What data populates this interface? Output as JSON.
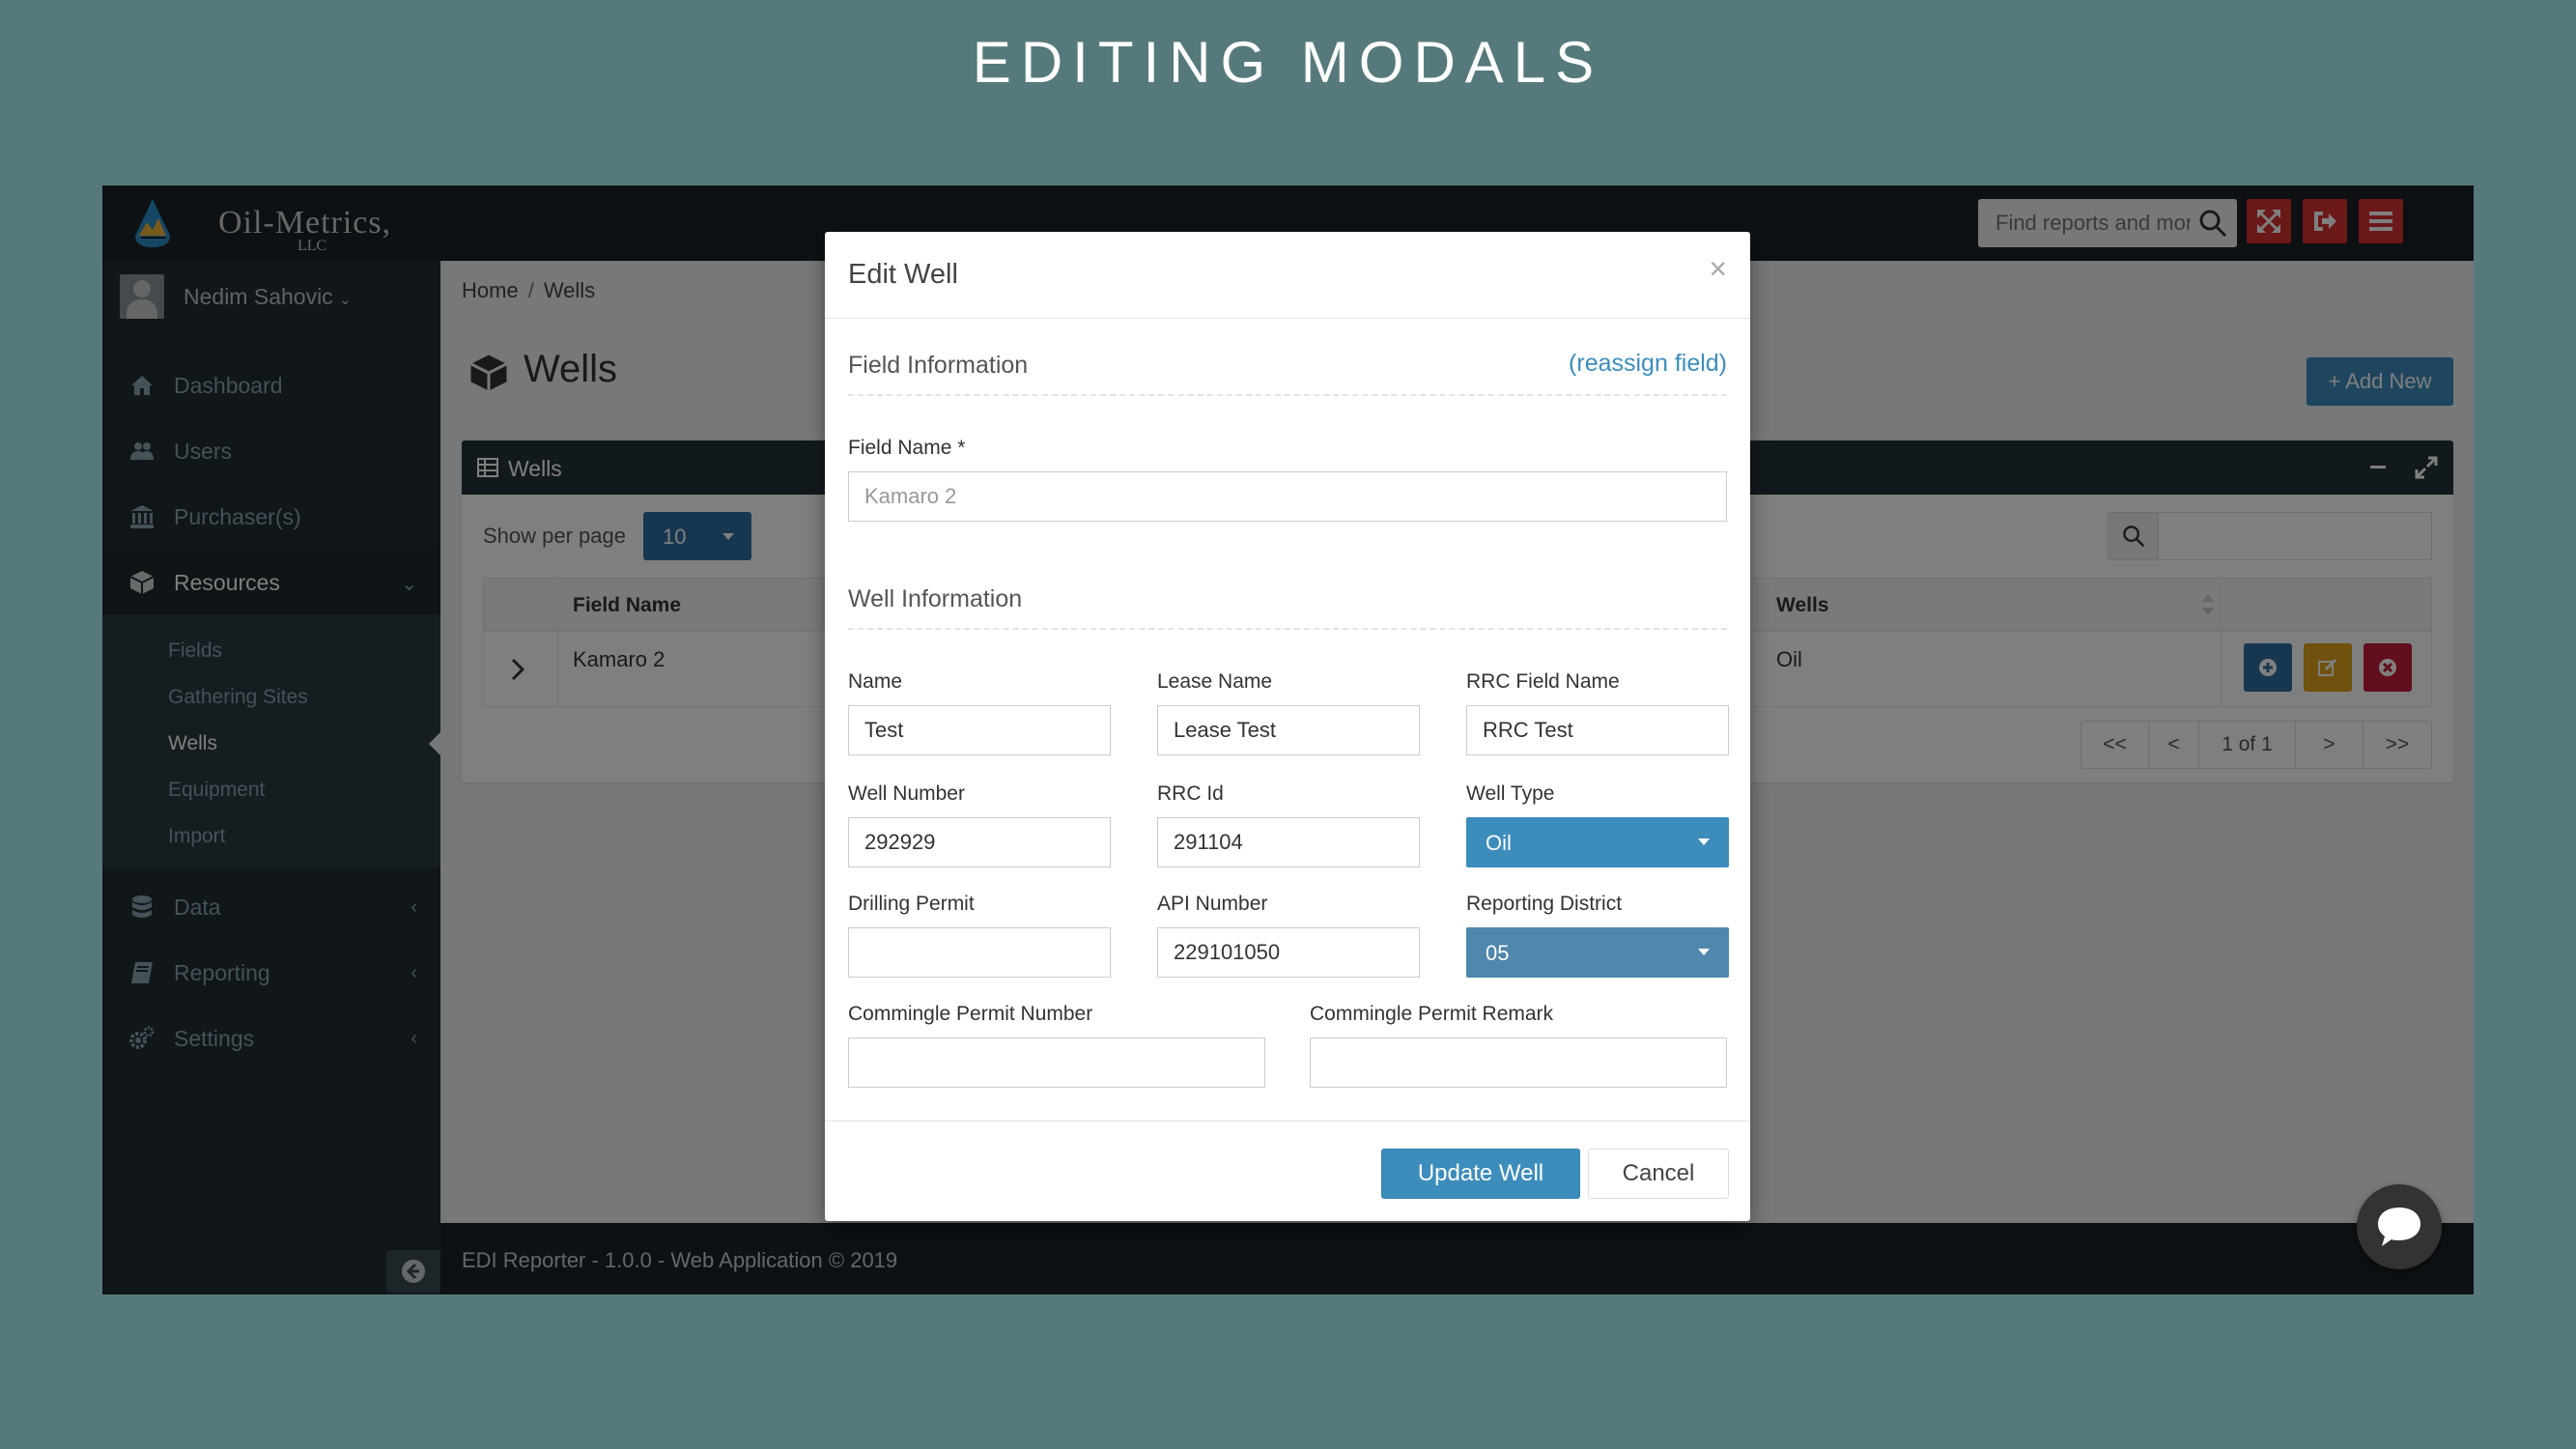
{
  "slide": {
    "title": "EDITING MODALS"
  },
  "topbar": {
    "brand": "Oil-Metrics,",
    "brand_sub": "LLC",
    "search_placeholder": "Find reports and more",
    "icons": [
      "search-icon",
      "expand-icon",
      "sign-out-icon",
      "menu-icon"
    ],
    "accent_color": "#d73030"
  },
  "user": {
    "name": "Nedim Sahovic"
  },
  "sidebar": {
    "items": [
      {
        "label": "Dashboard",
        "icon": "home-icon"
      },
      {
        "label": "Users",
        "icon": "users-icon"
      },
      {
        "label": "Purchaser(s)",
        "icon": "bank-icon"
      },
      {
        "label": "Resources",
        "icon": "cube-icon"
      },
      {
        "label": "Data",
        "icon": "database-icon"
      },
      {
        "label": "Reporting",
        "icon": "book-icon"
      },
      {
        "label": "Settings",
        "icon": "cogs-icon"
      }
    ],
    "resources_sub": [
      "Fields",
      "Gathering Sites",
      "Wells",
      "Equipment",
      "Import"
    ]
  },
  "breadcrumb": {
    "home": "Home",
    "current": "Wells"
  },
  "page": {
    "title": "Wells",
    "add_label": "Add New"
  },
  "table_box": {
    "title": "Wells",
    "show_per_page_label": "Show per page",
    "per_page": "10",
    "columns": [
      "Field Name",
      "Wells"
    ],
    "rows": [
      {
        "field_name": "Kamaro 2",
        "wells": "Oil"
      }
    ],
    "pager": {
      "first": "<<",
      "prev": "<",
      "info": "1 of 1",
      "next": ">",
      "last": ">>"
    }
  },
  "footer": {
    "text": "EDI Reporter - 1.0.0 - Web Application © 2019"
  },
  "modal": {
    "title": "Edit Well",
    "close": "×",
    "field_section": "Field Information",
    "reassign": "(reassign field)",
    "field_name_label": "Field Name *",
    "field_name_value": "Kamaro 2",
    "well_section": "Well Information",
    "fields": {
      "name_label": "Name",
      "name_value": "Test",
      "lease_label": "Lease Name",
      "lease_value": "Lease Test",
      "rrc_field_label": "RRC Field Name",
      "rrc_field_value": "RRC Test",
      "well_number_label": "Well Number",
      "well_number_value": "292929",
      "rrc_id_label": "RRC Id",
      "rrc_id_value": "291104",
      "well_type_label": "Well Type",
      "well_type_value": "Oil",
      "drilling_label": "Drilling Permit",
      "drilling_value": "",
      "api_label": "API Number",
      "api_value": "229101050",
      "district_label": "Reporting District",
      "district_value": "05",
      "commingle_number_label": "Commingle Permit Number",
      "commingle_number_value": "",
      "commingle_remark_label": "Commingle Permit Remark",
      "commingle_remark_value": ""
    },
    "update_label": "Update Well",
    "cancel_label": "Cancel"
  }
}
